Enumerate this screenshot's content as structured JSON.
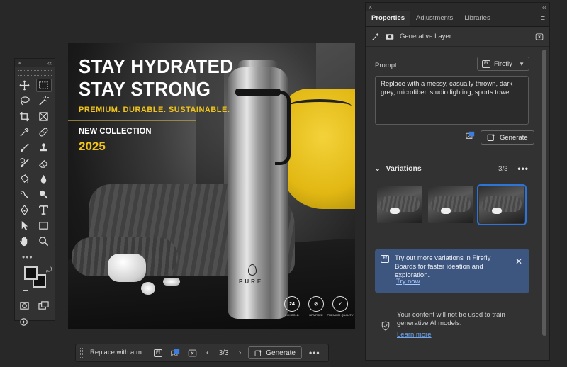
{
  "toolbox": {
    "close": "×",
    "collapse": "‹‹",
    "tools": [
      "move-tool",
      "marquee-tool",
      "lasso-tool",
      "magic-wand-tool",
      "crop-tool",
      "frame-tool",
      "eyedropper-tool",
      "healing-tool",
      "brush-tool",
      "stamp-tool",
      "history-brush-tool",
      "eraser-tool",
      "gradient-tool",
      "blur-tool",
      "dodge-tool",
      "sharpen-tool",
      "pen-tool",
      "type-tool",
      "path-selection-tool",
      "shape-tool",
      "hand-tool",
      "zoom-tool"
    ],
    "more": "•••",
    "active_tool": "marquee-tool"
  },
  "canvas": {
    "headline_line1": "STAY HYDRATED",
    "headline_line2": "STAY STRONG",
    "tagline": "PREMIUM. DURABLE. SUSTAINABLE.",
    "collection": "NEW COLLECTION",
    "year": "2025",
    "brand": "PURE",
    "badges": [
      {
        "icon": "24",
        "label": "24H COLD"
      },
      {
        "icon": "⊘",
        "label": "BPA FREE"
      },
      {
        "icon": "✓",
        "label": "PREMIUM QUALITY"
      }
    ],
    "colors": {
      "accent": "#f0c419",
      "text": "#ffffff"
    }
  },
  "taskbar": {
    "prompt_preview": "Replace with a m",
    "prev": "‹",
    "next": "›",
    "count": "3/3",
    "generate_label": "Generate",
    "more": "•••"
  },
  "panel": {
    "close": "×",
    "collapse": "‹‹",
    "tabs": [
      {
        "label": "Properties",
        "active": true
      },
      {
        "label": "Adjustments",
        "active": false
      },
      {
        "label": "Libraries",
        "active": false
      }
    ],
    "menu": "≡",
    "layer_type": "Generative Layer",
    "prompt_label": "Prompt",
    "model": "Firefly",
    "model_badge": "Ff",
    "prompt_text": "Replace with a messy, casually thrown, dark grey, microfiber, studio lighting, sports towel",
    "generate_label": "Generate",
    "variations_label": "Variations",
    "variations_count": "3/3",
    "variations_more": "•••",
    "selected_variation": 3,
    "promo_text": "Try out more variations in Firefly Boards for faster ideation and exploration.",
    "promo_link": "Try now",
    "promo_close": "✕",
    "privacy_text": "Your content will not be used to train generative AI models.",
    "privacy_link": "Learn more",
    "colors": {
      "promo_bg": "#3d5680",
      "selection": "#2d74d8",
      "link": "#6fa6f0"
    }
  }
}
